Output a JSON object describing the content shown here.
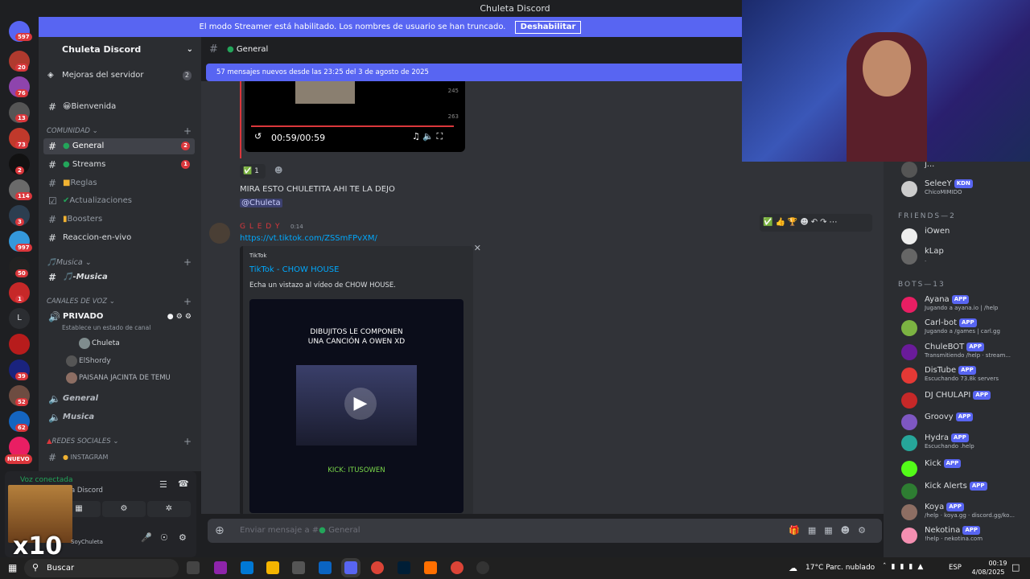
{
  "window": {
    "title": "Chuleta Discord"
  },
  "streamer": {
    "text": "El modo Streamer está habilitado. Los nombres de usuario se han truncado.",
    "button": "Deshabilitar"
  },
  "server": {
    "name": "Chuleta Discord",
    "boost_label": "Mejoras del servidor",
    "boost_count": "2"
  },
  "channels": {
    "bienvenida": "Bienvenida",
    "cat_comunidad": "COMUNIDAD",
    "general": "General",
    "general_count": "2",
    "streams": "Streams",
    "streams_count": "1",
    "reglas": "Reglas",
    "actualizaciones": "Actualizaciones",
    "boosters": "Boosters",
    "reaccion": "Reaccion-en-vivo",
    "cat_musica": "Musica",
    "musica": "-Musica",
    "cat_voz": "CANALES DE VOZ",
    "privado": "PRIVADO",
    "privado_status": "Establece un estado de canal",
    "voice_users": [
      "Chuleta",
      "ElShordy",
      "PAISANA JACINTA DE TEMU"
    ],
    "voice_general": "General",
    "voice_musica": "Musica",
    "cat_redes": "REDES SOCIALES",
    "instagram": "INSTAGRAM"
  },
  "voice_panel": {
    "status": "Voz conectada",
    "server": "a Discord",
    "user": "SoyChuleta",
    "overlay": "x10"
  },
  "guild_badges": [
    "597",
    "20",
    "76",
    "13",
    "73",
    "2",
    "114",
    "3",
    "997",
    "50",
    "1",
    "39",
    "52",
    "62"
  ],
  "guild_new": "NUEVO",
  "guild_letter": "L",
  "chat": {
    "channel": "General",
    "new_banner": "57 mensajes nuevos desde las 23:25 del 3 de agosto de 2025",
    "video_time": "00:59/00:59",
    "video_likes": "245",
    "video_shares": "263",
    "reaction_count": "1",
    "msg1": "MIRA ESTO CHULETITA AHI TE LA DEJO",
    "mention": "@Chuleta",
    "author2": "G L E D Y",
    "time2": "0:14",
    "link": "https://vt.tiktok.com/ZSSmFPvXM/",
    "embed_provider": "TikTok",
    "embed_title": "TikTok - CHOW HOUSE",
    "embed_desc": "Echa un vistazo al vídeo de CHOW HOUSE.",
    "thumb_line1": "DIBUJITOS LE COMPONEN",
    "thumb_line2": "UNA CANCIÓN A OWEN XD",
    "thumb_footer": "KICK: ITUSOWEN",
    "composer_placeholder": "Enviar mensaje a #",
    "composer_channel": "General"
  },
  "members": {
    "top": [
      {
        "name": "j...",
        "status": ""
      },
      {
        "name": "SeleeY",
        "tag": "KDN",
        "status": "ChicoMIMIDO"
      }
    ],
    "friends_header": "FRIENDS—2",
    "friends": [
      {
        "name": "iOwen",
        "status": ""
      },
      {
        "name": "kLap",
        "status": "."
      }
    ],
    "bots_header": "BOTS—13",
    "bots": [
      {
        "name": "Ayana",
        "status": "Jugando a ayana.io | /help",
        "color": "#e91e63"
      },
      {
        "name": "Carl-bot",
        "status": "Jugando a /games | carl.gg",
        "color": "#7cb342"
      },
      {
        "name": "ChuleBOT",
        "status": "Transmitiendo /help · stream...",
        "color": "#6a1b9a"
      },
      {
        "name": "DisTube",
        "status": "Escuchando 73.8k servers",
        "color": "#e53935"
      },
      {
        "name": "DJ CHULAPI",
        "status": "",
        "color": "#c62828"
      },
      {
        "name": "Groovy",
        "status": "",
        "color": "#7e57c2"
      },
      {
        "name": "Hydra",
        "status": "Escuchando .help",
        "color": "#26a69a"
      },
      {
        "name": "Kick",
        "status": "",
        "color": "#53fc18"
      },
      {
        "name": "Kick Alerts",
        "status": "",
        "color": "#2e7d32"
      },
      {
        "name": "Koya",
        "status": "/help · koya.gg · discord.gg/ko...",
        "color": "#8d6e63"
      },
      {
        "name": "Nekotina",
        "status": "!help · nekotina.com",
        "color": "#f48fb1"
      }
    ],
    "app_label": "APP"
  },
  "taskbar": {
    "search": "Buscar",
    "weather": "17°C  Parc. nublado",
    "lang": "ESP",
    "time": "00:19",
    "date": "4/08/2025"
  }
}
